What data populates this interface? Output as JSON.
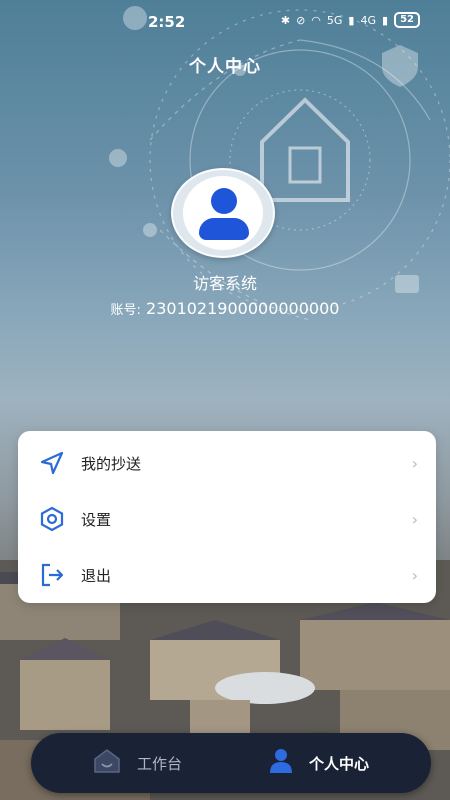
{
  "status_bar": {
    "time": "2:52",
    "network_label": "5G",
    "network_label_2": "4G",
    "battery": "52"
  },
  "header": {
    "title": "个人中心"
  },
  "profile": {
    "name": "访客系统",
    "account_label": "账号:",
    "account_number": "2301021900000000000"
  },
  "menu": {
    "items": [
      {
        "label": "我的抄送",
        "icon": "send-icon"
      },
      {
        "label": "设置",
        "icon": "settings-hex-icon"
      },
      {
        "label": "退出",
        "icon": "logout-icon"
      }
    ]
  },
  "tab_bar": {
    "tabs": [
      {
        "label": "工作台",
        "icon": "workbench-icon",
        "active": false
      },
      {
        "label": "个人中心",
        "icon": "user-icon",
        "active": true
      }
    ],
    "active_color": "#ffffff",
    "inactive_color": "#b0b6c3"
  },
  "colors": {
    "accent": "#1f56d9",
    "tab_bar_bg": "#1a2236"
  }
}
